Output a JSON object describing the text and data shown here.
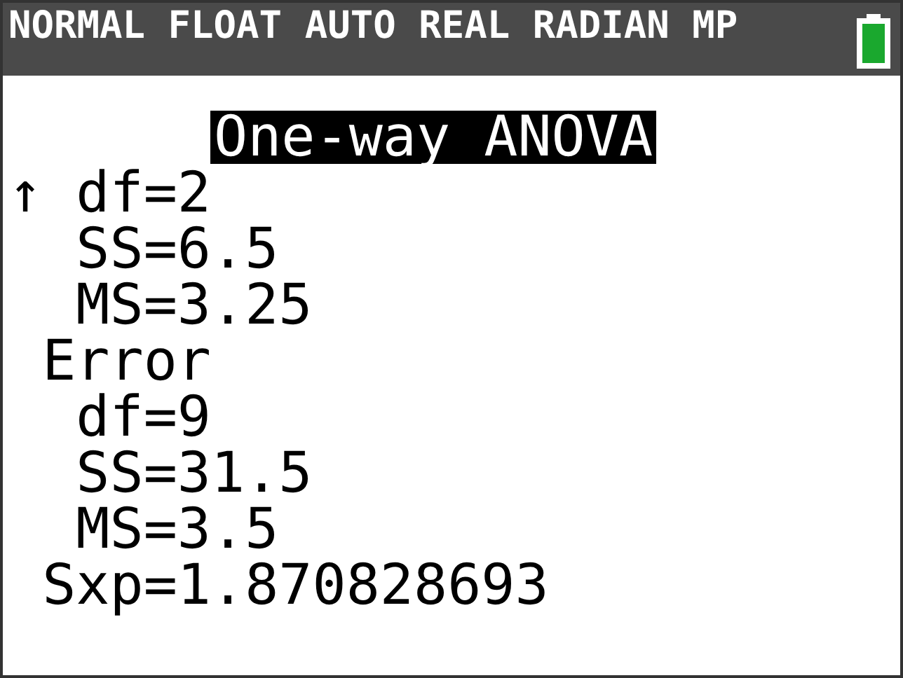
{
  "status_bar": {
    "modes": "NORMAL FLOAT AUTO REAL RADIAN MP"
  },
  "screen": {
    "title": "One-way ANOVA",
    "scroll_indicator": "↑",
    "items": [
      {
        "children": [
          {
            "text": "df=2"
          },
          {
            "text": "SS=6.5"
          },
          {
            "text": "MS=3.25"
          }
        ]
      },
      {
        "text": "Error",
        "children": [
          {
            "text": "df=9"
          },
          {
            "text": "SS=31.5"
          },
          {
            "text": "MS=3.5"
          }
        ]
      },
      {
        "text": "Sxp=1.870828693"
      }
    ]
  }
}
